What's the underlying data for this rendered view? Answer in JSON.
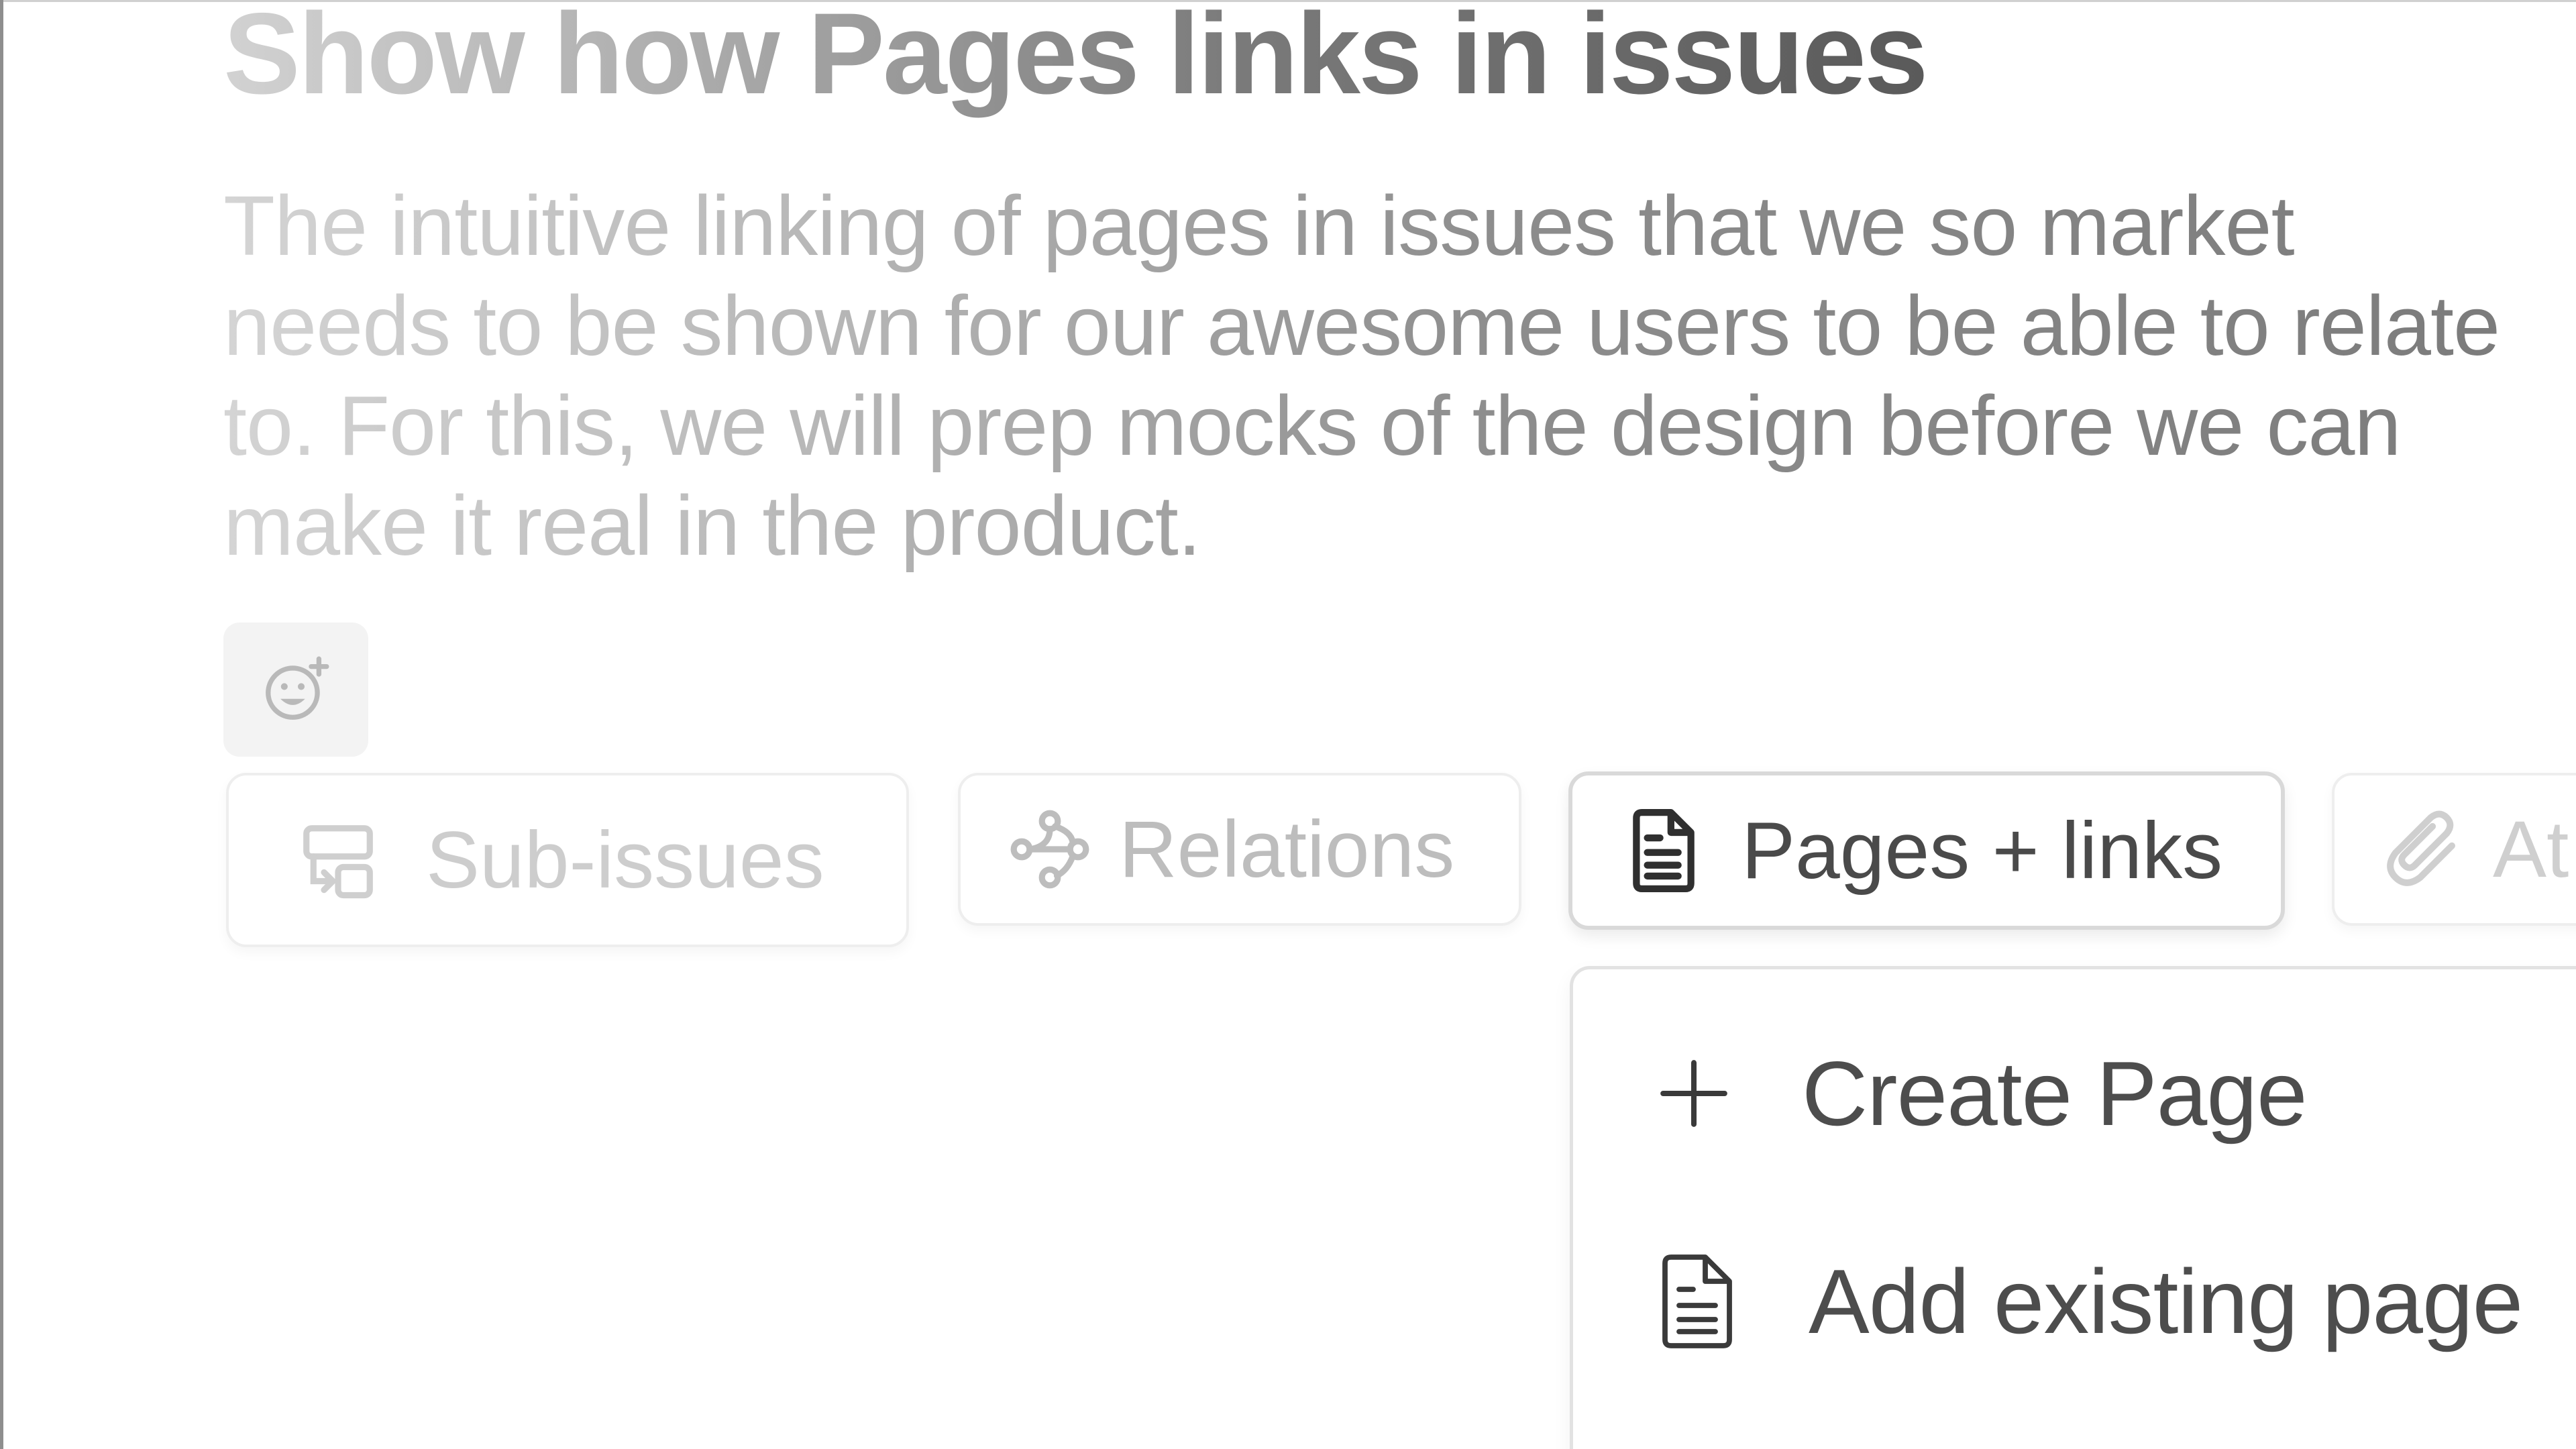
{
  "issue": {
    "title": "Show how Pages links in issues",
    "description": "The intuitive linking of pages in issues that we so market needs to be shown for our awesome users to be able to relate to. For this, we will prep mocks of the design before we can make it real in the product."
  },
  "reaction": {
    "icon": "emoji-add-icon"
  },
  "tabs": [
    {
      "label": "Sub-issues",
      "icon": "sub-issues-icon"
    },
    {
      "label": "Relations",
      "icon": "relations-icon"
    },
    {
      "label": "Pages + links",
      "icon": "page-icon",
      "active": true
    },
    {
      "label": "At",
      "icon": "paperclip-icon"
    }
  ],
  "dropdown": {
    "items": [
      {
        "label": "Create Page",
        "icon": "plus-icon"
      },
      {
        "label": "Add existing page",
        "icon": "page-icon"
      }
    ]
  }
}
